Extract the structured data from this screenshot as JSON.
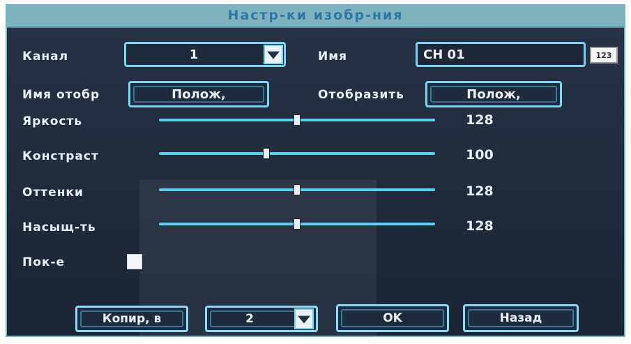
{
  "window": {
    "title": "Настр-ки изобр-ния"
  },
  "rows": {
    "channel": {
      "label": "Канал",
      "value": "1"
    },
    "name": {
      "label": "Имя",
      "value": "CH 01",
      "keyboard_icon_text": "123"
    },
    "display_name": {
      "label": "Имя отобр",
      "value": "Полож,"
    },
    "display": {
      "label": "Отобразить",
      "value": "Полож,"
    },
    "brightness": {
      "label": "Яркость",
      "value": "128",
      "level": 0.5
    },
    "contrast": {
      "label": "Констраст",
      "value": "100",
      "level": 0.39
    },
    "hue": {
      "label": "Оттенки",
      "value": "128",
      "level": 0.5
    },
    "saturation": {
      "label": "Насыщ-ть",
      "value": "128",
      "level": 0.5
    },
    "show": {
      "label": "Пок-е",
      "checked": false
    }
  },
  "footer": {
    "copy_label": "Копир, в",
    "copy_target": "2",
    "ok_label": "OK",
    "back_label": "Назад"
  },
  "colors": {
    "accent": "#79d4f2",
    "title_bar": "#7fb3bd",
    "background": "#1f2a3a"
  }
}
